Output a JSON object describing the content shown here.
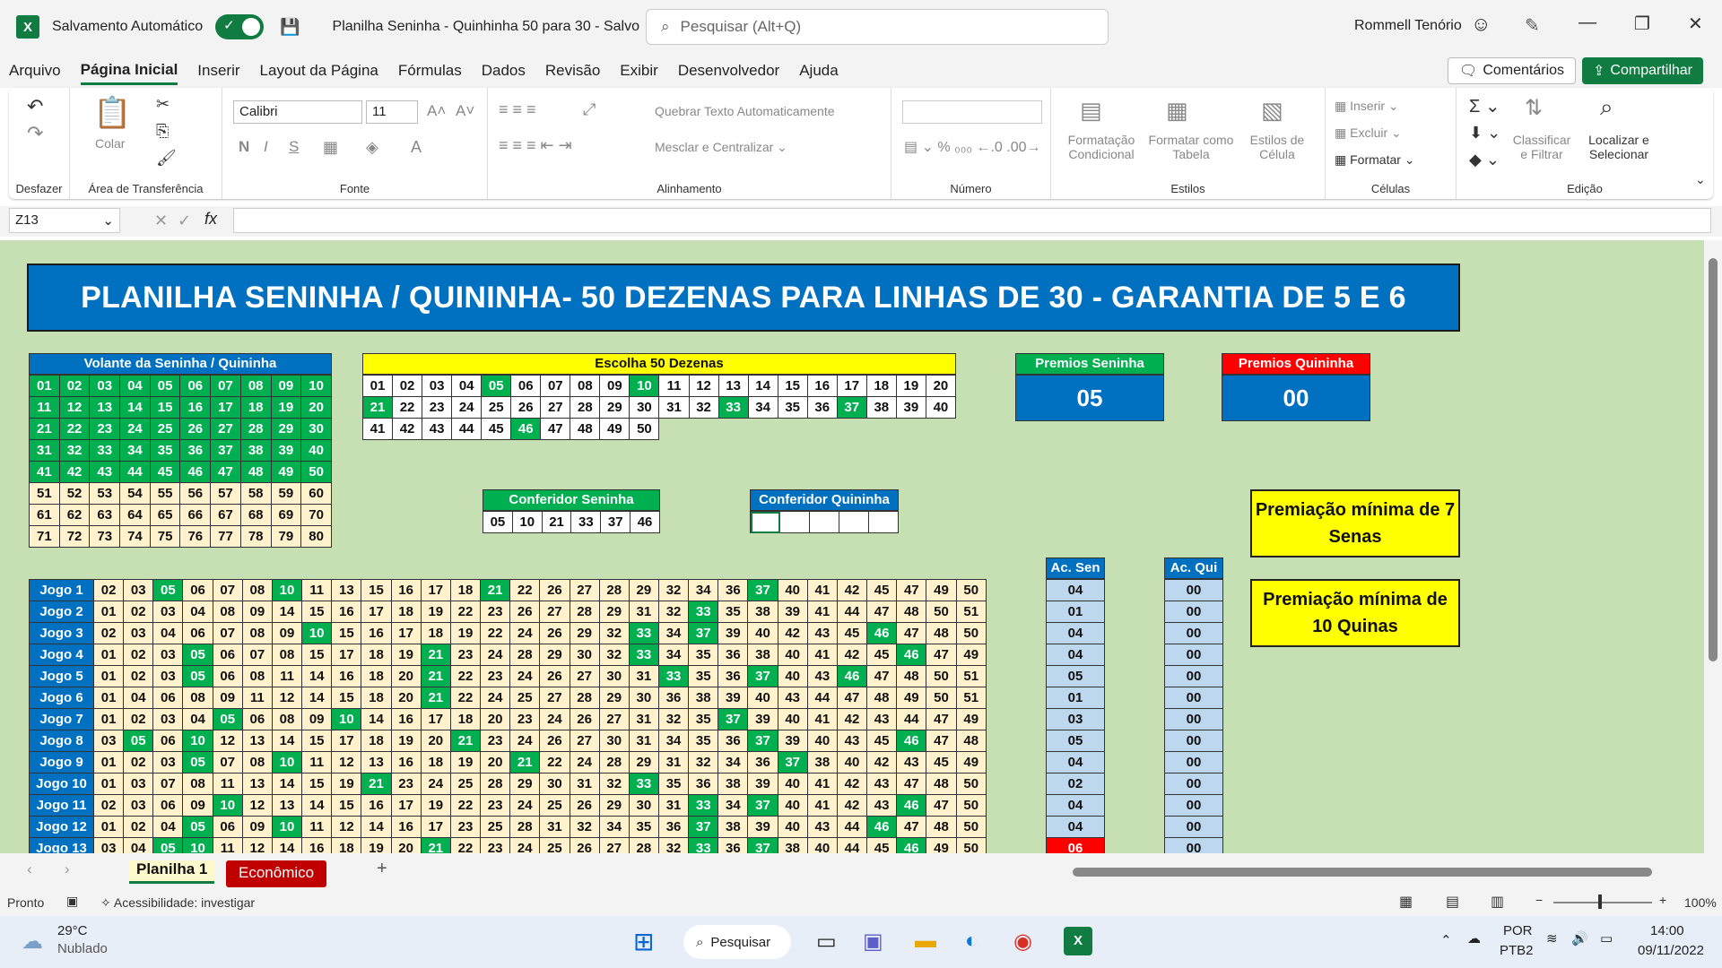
{
  "titlebar": {
    "autosave_label": "Salvamento Automático",
    "doc_title": "Planilha Seninha - Quinhinha 50 para 30  -  Salvo",
    "search_placeholder": "Pesquisar (Alt+Q)",
    "user": "Rommell Tenório"
  },
  "menu": [
    "Arquivo",
    "Página Inicial",
    "Inserir",
    "Layout da Página",
    "Fórmulas",
    "Dados",
    "Revisão",
    "Exibir",
    "Desenvolvedor",
    "Ajuda"
  ],
  "actions": {
    "comments": "Comentários",
    "share": "Compartilhar"
  },
  "ribbon": {
    "undo_label": "Desfazer",
    "paste": "Colar",
    "clipboard": "Área de Transferência",
    "font_name": "Calibri",
    "font_size": "11",
    "font_group": "Fonte",
    "wrap": "Quebrar Texto Automaticamente",
    "merge": "Mesclar e Centralizar",
    "align_group": "Alinhamento",
    "number_group": "Número",
    "cond_format": "Formatação Condicional",
    "format_table": "Formatar como Tabela",
    "cell_styles": "Estilos de Célula",
    "styles_group": "Estilos",
    "insert": "Inserir",
    "delete": "Excluir",
    "format": "Formatar",
    "cells_group": "Células",
    "sort": "Classificar e Filtrar",
    "find": "Localizar e Selecionar",
    "edit_group": "Edição"
  },
  "formula": {
    "namebox": "Z13",
    "value": ""
  },
  "sheet": {
    "banner": "PLANILHA SENINHA / QUININHA- 50 DEZENAS PARA LINHAS DE 30 - GARANTIA DE 5 E 6",
    "volante_title": "Volante da Seninha / Quininha",
    "escolha_title": "Escolha 50 Dezenas",
    "escolha_highlight": [
      "05",
      "10",
      "21",
      "33",
      "37",
      "46"
    ],
    "premios_sen_label": "Premios Seninha",
    "premios_sen": "05",
    "premios_qui_label": "Premios Quininha",
    "premios_qui": "00",
    "conf_sen_label": "Conferidor Seninha",
    "conf_sen": [
      "05",
      "10",
      "21",
      "33",
      "37",
      "46"
    ],
    "conf_qui_label": "Conferidor Quininha",
    "min_senas": "Premiação mínima de 7 Senas",
    "min_quinas": "Premiação mínima de 10 Quinas",
    "acsen_label": "Ac. Sen",
    "acqui_label": "Ac. Qui",
    "jogos": [
      {
        "label": "Jogo 1",
        "nums": [
          "02",
          "03",
          "05",
          "06",
          "07",
          "08",
          "10",
          "11",
          "13",
          "15",
          "16",
          "17",
          "18",
          "21",
          "22",
          "26",
          "27",
          "28",
          "29",
          "32",
          "34",
          "36",
          "37",
          "40",
          "41",
          "42",
          "45",
          "47",
          "49",
          "50"
        ],
        "sen": "04",
        "qui": "00"
      },
      {
        "label": "Jogo 2",
        "nums": [
          "01",
          "02",
          "03",
          "04",
          "08",
          "09",
          "14",
          "15",
          "16",
          "17",
          "18",
          "19",
          "22",
          "23",
          "26",
          "27",
          "28",
          "29",
          "31",
          "32",
          "33",
          "35",
          "38",
          "39",
          "41",
          "44",
          "47",
          "48",
          "50",
          "51"
        ],
        "sen": "01",
        "qui": "00"
      },
      {
        "label": "Jogo 3",
        "nums": [
          "02",
          "03",
          "04",
          "06",
          "07",
          "08",
          "09",
          "10",
          "15",
          "16",
          "17",
          "18",
          "19",
          "22",
          "24",
          "26",
          "29",
          "32",
          "33",
          "34",
          "37",
          "39",
          "40",
          "42",
          "43",
          "45",
          "46",
          "47",
          "48",
          "50"
        ],
        "sen": "04",
        "qui": "00"
      },
      {
        "label": "Jogo 4",
        "nums": [
          "01",
          "02",
          "03",
          "05",
          "06",
          "07",
          "08",
          "15",
          "17",
          "18",
          "19",
          "21",
          "23",
          "24",
          "28",
          "29",
          "30",
          "32",
          "33",
          "34",
          "35",
          "36",
          "38",
          "40",
          "41",
          "42",
          "45",
          "46",
          "47",
          "49"
        ],
        "sen": "04",
        "qui": "00"
      },
      {
        "label": "Jogo 5",
        "nums": [
          "01",
          "02",
          "03",
          "05",
          "06",
          "08",
          "11",
          "14",
          "16",
          "18",
          "20",
          "21",
          "22",
          "23",
          "24",
          "26",
          "27",
          "30",
          "31",
          "33",
          "35",
          "36",
          "37",
          "40",
          "43",
          "46",
          "47",
          "48",
          "50",
          "51"
        ],
        "sen": "05",
        "qui": "00"
      },
      {
        "label": "Jogo 6",
        "nums": [
          "01",
          "04",
          "06",
          "08",
          "09",
          "11",
          "12",
          "14",
          "15",
          "18",
          "20",
          "21",
          "22",
          "24",
          "25",
          "27",
          "28",
          "29",
          "30",
          "36",
          "38",
          "39",
          "40",
          "43",
          "44",
          "47",
          "48",
          "49",
          "50",
          "51"
        ],
        "sen": "01",
        "qui": "00"
      },
      {
        "label": "Jogo 7",
        "nums": [
          "01",
          "02",
          "03",
          "04",
          "05",
          "06",
          "08",
          "09",
          "10",
          "14",
          "16",
          "17",
          "18",
          "20",
          "23",
          "24",
          "26",
          "27",
          "31",
          "32",
          "35",
          "37",
          "39",
          "40",
          "41",
          "42",
          "43",
          "44",
          "47",
          "49"
        ],
        "sen": "03",
        "qui": "00"
      },
      {
        "label": "Jogo 8",
        "nums": [
          "03",
          "05",
          "06",
          "10",
          "12",
          "13",
          "14",
          "15",
          "17",
          "18",
          "19",
          "20",
          "21",
          "23",
          "24",
          "26",
          "27",
          "30",
          "31",
          "34",
          "35",
          "36",
          "37",
          "39",
          "40",
          "43",
          "45",
          "46",
          "47",
          "48"
        ],
        "sen": "05",
        "qui": "00"
      },
      {
        "label": "Jogo 9",
        "nums": [
          "01",
          "02",
          "03",
          "05",
          "07",
          "08",
          "10",
          "11",
          "12",
          "13",
          "16",
          "18",
          "19",
          "20",
          "21",
          "22",
          "24",
          "28",
          "29",
          "31",
          "32",
          "34",
          "36",
          "37",
          "38",
          "40",
          "42",
          "43",
          "45",
          "49"
        ],
        "sen": "04",
        "qui": "00"
      },
      {
        "label": "Jogo 10",
        "nums": [
          "01",
          "03",
          "07",
          "08",
          "11",
          "13",
          "14",
          "15",
          "19",
          "21",
          "23",
          "24",
          "25",
          "28",
          "29",
          "30",
          "31",
          "32",
          "33",
          "35",
          "36",
          "38",
          "39",
          "40",
          "41",
          "42",
          "43",
          "47",
          "48",
          "50"
        ],
        "sen": "02",
        "qui": "00"
      },
      {
        "label": "Jogo 11",
        "nums": [
          "02",
          "03",
          "06",
          "09",
          "10",
          "12",
          "13",
          "14",
          "15",
          "16",
          "17",
          "19",
          "22",
          "23",
          "24",
          "25",
          "26",
          "29",
          "30",
          "31",
          "33",
          "34",
          "37",
          "40",
          "41",
          "42",
          "43",
          "46",
          "47",
          "50"
        ],
        "sen": "04",
        "qui": "00"
      },
      {
        "label": "Jogo 12",
        "nums": [
          "01",
          "02",
          "04",
          "05",
          "06",
          "09",
          "10",
          "11",
          "12",
          "14",
          "16",
          "17",
          "23",
          "25",
          "28",
          "31",
          "32",
          "34",
          "35",
          "36",
          "37",
          "38",
          "39",
          "40",
          "43",
          "44",
          "46",
          "47",
          "48",
          "50"
        ],
        "sen": "04",
        "qui": "00"
      },
      {
        "label": "Jogo 13",
        "nums": [
          "03",
          "04",
          "05",
          "10",
          "11",
          "12",
          "14",
          "16",
          "18",
          "19",
          "20",
          "21",
          "22",
          "23",
          "24",
          "25",
          "26",
          "27",
          "28",
          "32",
          "33",
          "36",
          "37",
          "38",
          "40",
          "44",
          "45",
          "46",
          "49",
          "50"
        ],
        "sen": "06",
        "qui": "00"
      }
    ]
  },
  "sheettabs": [
    "Planilha 1",
    "Econômico"
  ],
  "status": {
    "ready": "Pronto",
    "access": "Acessibilidade: investigar",
    "zoom": "100%"
  },
  "taskbar": {
    "temp": "29°C",
    "weather": "Nublado",
    "search": "Pesquisar",
    "lang1": "POR",
    "lang2": "PTB2",
    "time": "14:00",
    "date": "09/11/2022"
  },
  "colors": {
    "excel_green": "#107c41",
    "cell_green": "#00b050",
    "blue": "#0070c0",
    "sheet_bg": "#c6e0b4"
  }
}
